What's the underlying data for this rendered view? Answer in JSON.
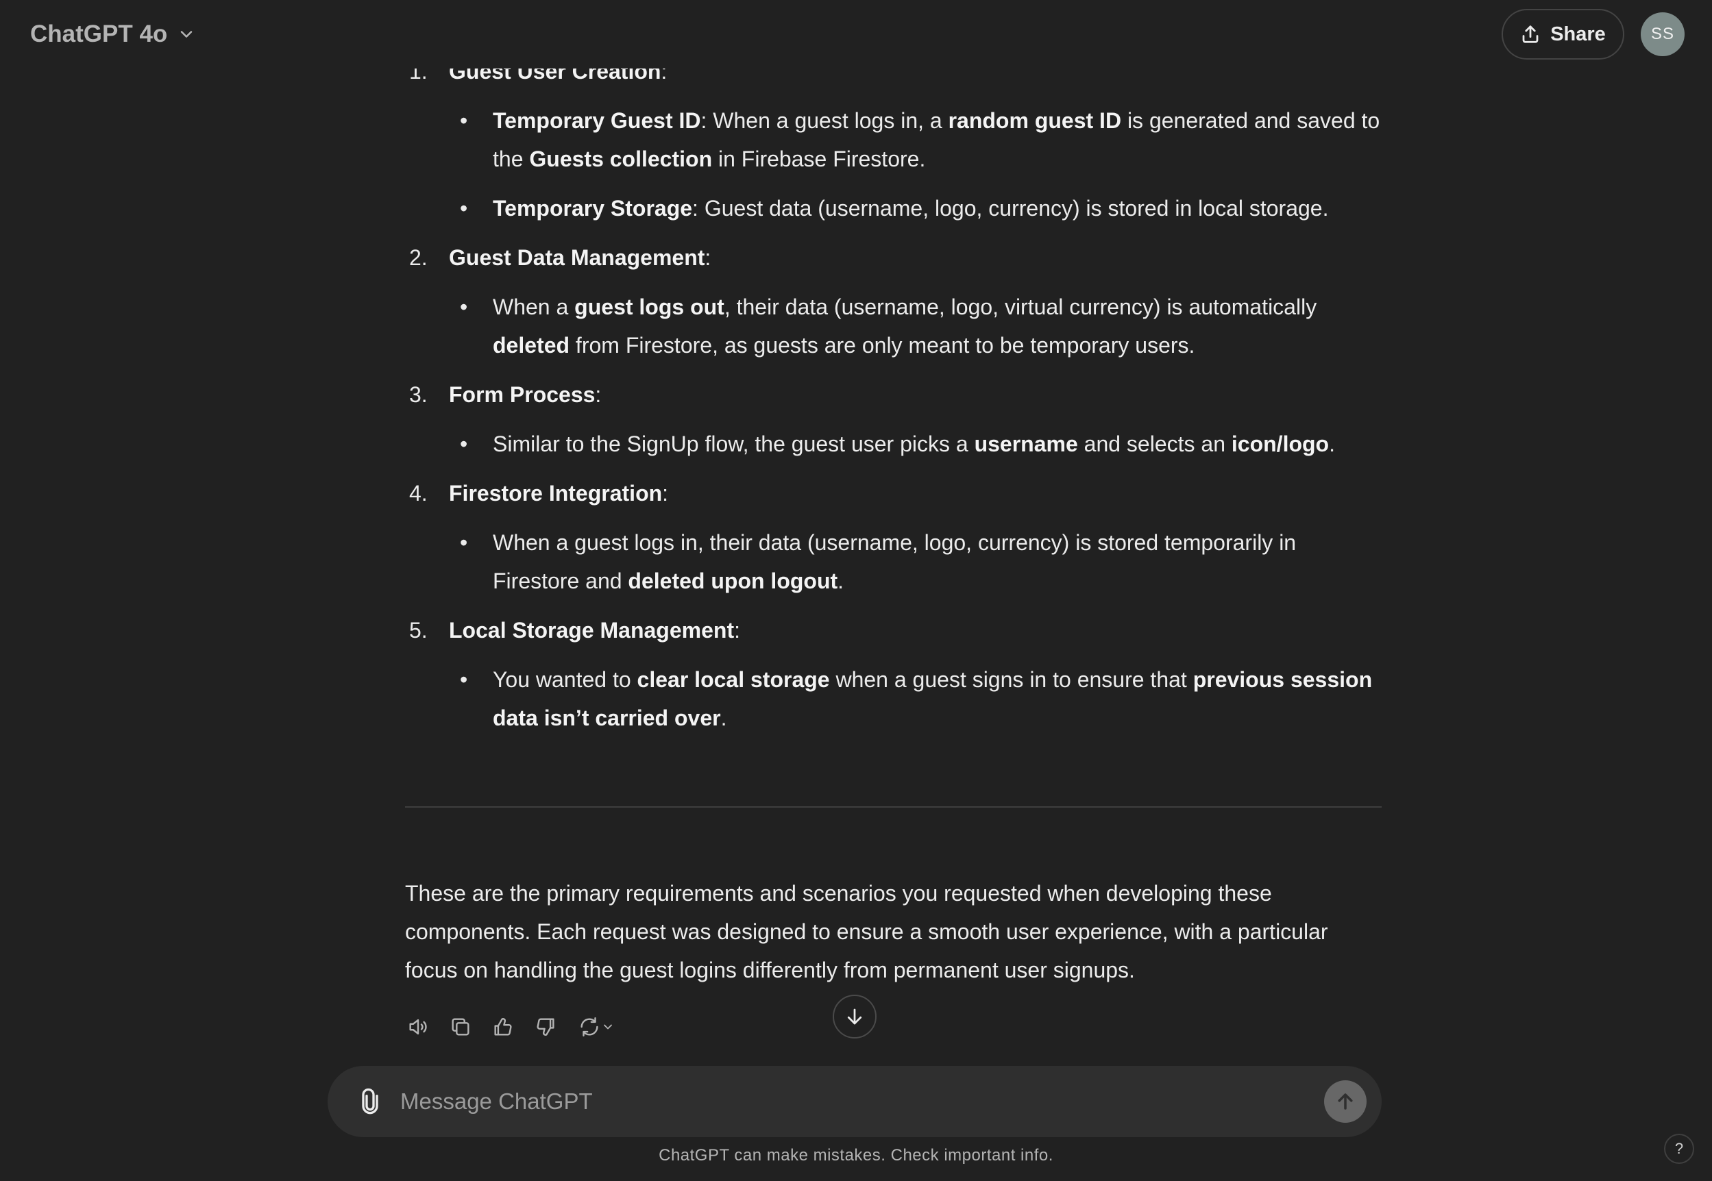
{
  "header": {
    "model_title": "ChatGPT 4o",
    "share_label": "Share",
    "avatar_initials": "SS"
  },
  "message": {
    "items": [
      {
        "number": "1.",
        "title": "Guest User Creation",
        "bullets": [
          [
            {
              "b": "Temporary Guest ID"
            },
            {
              "t": ": When a guest logs in, a "
            },
            {
              "b": "random guest ID"
            },
            {
              "t": " is generated and saved to the "
            },
            {
              "b": "Guests collection"
            },
            {
              "t": " in Firebase Firestore."
            }
          ],
          [
            {
              "b": "Temporary Storage"
            },
            {
              "t": ": Guest data (username, logo, currency) is stored in local storage."
            }
          ]
        ]
      },
      {
        "number": "2.",
        "title": "Guest Data Management",
        "bullets": [
          [
            {
              "t": "When a "
            },
            {
              "b": "guest logs out"
            },
            {
              "t": ", their data (username, logo, virtual currency) is automatically "
            },
            {
              "b": "deleted"
            },
            {
              "t": " from Firestore, as guests are only meant to be temporary users."
            }
          ]
        ]
      },
      {
        "number": "3.",
        "title": "Form Process",
        "bullets": [
          [
            {
              "t": "Similar to the SignUp flow, the guest user picks a "
            },
            {
              "b": "username"
            },
            {
              "t": " and selects an "
            },
            {
              "b": "icon/logo"
            },
            {
              "t": "."
            }
          ]
        ]
      },
      {
        "number": "4.",
        "title": "Firestore Integration",
        "bullets": [
          [
            {
              "t": "When a guest logs in, their data (username, logo, currency) is stored temporarily in Firestore and "
            },
            {
              "b": "deleted upon logout"
            },
            {
              "t": "."
            }
          ]
        ]
      },
      {
        "number": "5.",
        "title": "Local Storage Management",
        "bullets": [
          [
            {
              "t": "You wanted to "
            },
            {
              "b": "clear local storage"
            },
            {
              "t": " when a guest signs in to ensure that "
            },
            {
              "b": "previous session data isn’t carried over"
            },
            {
              "t": "."
            }
          ]
        ]
      }
    ],
    "closing": "These are the primary requirements and scenarios you requested when developing these components. Each request was designed to ensure a smooth user experience, with a particular focus on handling the guest logins differently from permanent user signups."
  },
  "actions": {
    "icons": [
      "read-aloud-icon",
      "copy-icon",
      "thumbs-up-icon",
      "thumbs-down-icon",
      "regenerate-icon"
    ]
  },
  "composer": {
    "placeholder": "Message ChatGPT"
  },
  "footer": {
    "disclaimer": "ChatGPT can make mistakes. Check important info.",
    "help_label": "?"
  }
}
